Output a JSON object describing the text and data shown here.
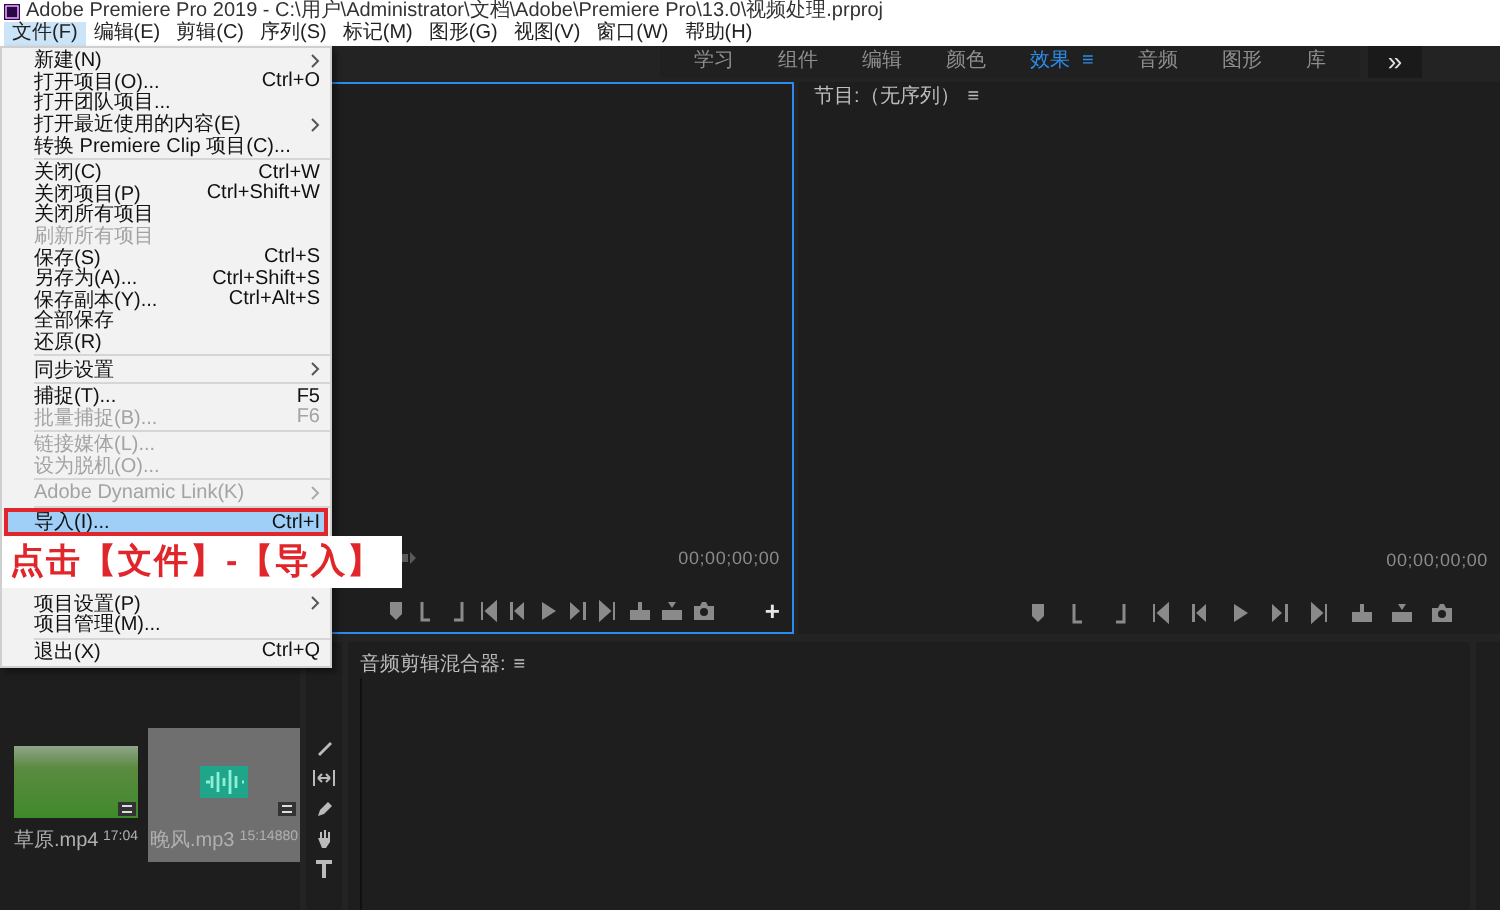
{
  "window": {
    "title": "Adobe Premiere Pro 2019 - C:\\用户\\Administrator\\文档\\Adobe\\Premiere Pro\\13.0\\视频处理.prproj"
  },
  "menu_bar": [
    {
      "label": "文件(F)",
      "selected": true
    },
    {
      "label": "编辑(E)",
      "selected": false
    },
    {
      "label": "剪辑(C)",
      "selected": false
    },
    {
      "label": "序列(S)",
      "selected": false
    },
    {
      "label": "标记(M)",
      "selected": false
    },
    {
      "label": "图形(G)",
      "selected": false
    },
    {
      "label": "视图(V)",
      "selected": false
    },
    {
      "label": "窗口(W)",
      "selected": false
    },
    {
      "label": "帮助(H)",
      "selected": false
    }
  ],
  "file_menu": {
    "items": [
      {
        "kind": "item",
        "label": "新建(N)",
        "submenu": true,
        "disabled": false,
        "selected": false
      },
      {
        "kind": "item",
        "label": "打开项目(O)...",
        "shortcut": "Ctrl+O",
        "disabled": false,
        "selected": false
      },
      {
        "kind": "item",
        "label": "打开团队项目...",
        "disabled": false,
        "selected": false
      },
      {
        "kind": "item",
        "label": "打开最近使用的内容(E)",
        "submenu": true,
        "disabled": false,
        "selected": false
      },
      {
        "kind": "item",
        "label": "转换 Premiere Clip 项目(C)...",
        "disabled": false,
        "selected": false
      },
      {
        "kind": "separator"
      },
      {
        "kind": "item",
        "label": "关闭(C)",
        "shortcut": "Ctrl+W",
        "disabled": false,
        "selected": false
      },
      {
        "kind": "item",
        "label": "关闭项目(P)",
        "shortcut": "Ctrl+Shift+W",
        "disabled": false,
        "selected": false
      },
      {
        "kind": "item",
        "label": "关闭所有项目",
        "disabled": false,
        "selected": false
      },
      {
        "kind": "item",
        "label": "刷新所有项目",
        "disabled": true,
        "selected": false
      },
      {
        "kind": "item",
        "label": "保存(S)",
        "shortcut": "Ctrl+S",
        "disabled": false,
        "selected": false
      },
      {
        "kind": "item",
        "label": "另存为(A)...",
        "shortcut": "Ctrl+Shift+S",
        "disabled": false,
        "selected": false
      },
      {
        "kind": "item",
        "label": "保存副本(Y)...",
        "shortcut": "Ctrl+Alt+S",
        "disabled": false,
        "selected": false
      },
      {
        "kind": "item",
        "label": "全部保存",
        "disabled": false,
        "selected": false
      },
      {
        "kind": "item",
        "label": "还原(R)",
        "disabled": false,
        "selected": false
      },
      {
        "kind": "separator"
      },
      {
        "kind": "item",
        "label": "同步设置",
        "submenu": true,
        "disabled": false,
        "selected": false
      },
      {
        "kind": "separator"
      },
      {
        "kind": "item",
        "label": "捕捉(T)...",
        "shortcut": "F5",
        "disabled": false,
        "selected": false
      },
      {
        "kind": "item",
        "label": "批量捕捉(B)...",
        "shortcut": "F6",
        "disabled": true,
        "selected": false
      },
      {
        "kind": "separator"
      },
      {
        "kind": "item",
        "label": "链接媒体(L)...",
        "disabled": true,
        "selected": false
      },
      {
        "kind": "item",
        "label": "设为脱机(O)...",
        "disabled": true,
        "selected": false
      },
      {
        "kind": "separator"
      },
      {
        "kind": "item",
        "label": "Adobe Dynamic Link(K)",
        "submenu": true,
        "disabled": true,
        "selected": false
      },
      {
        "kind": "separator"
      },
      {
        "kind": "item",
        "label": "导入(I)...",
        "shortcut": "Ctrl+I",
        "disabled": false,
        "selected": true
      },
      {
        "kind": "callout",
        "label": "点击【文件】-【导入】"
      },
      {
        "kind": "item",
        "label": "项目设置(P)",
        "submenu": true,
        "disabled": false,
        "selected": false
      },
      {
        "kind": "item",
        "label": "项目管理(M)...",
        "disabled": false,
        "selected": false
      },
      {
        "kind": "separator"
      },
      {
        "kind": "item",
        "label": "退出(X)",
        "shortcut": "Ctrl+Q",
        "disabled": false,
        "selected": false
      }
    ]
  },
  "workspace_tabs": {
    "tabs": [
      {
        "label": "学习",
        "selected": false
      },
      {
        "label": "组件",
        "selected": false
      },
      {
        "label": "编辑",
        "selected": false
      },
      {
        "label": "颜色",
        "selected": false
      },
      {
        "label": "效果",
        "selected": true,
        "menu_glyph": "≡"
      },
      {
        "label": "音频",
        "selected": false
      },
      {
        "label": "图形",
        "selected": false
      },
      {
        "label": "库",
        "selected": false
      }
    ],
    "overflow_button": "»"
  },
  "source_panel": {
    "timecode": "00;00;00;00",
    "add_button": "+"
  },
  "program_panel": {
    "title": "节目:（无序列）",
    "menu_glyph": "≡",
    "timecode": "00;00;00;00"
  },
  "project_panel": {
    "items": [
      {
        "kind": "video",
        "name": "草原.mp4",
        "duration": "17:04",
        "selected": false
      },
      {
        "kind": "audio",
        "name": "晚风.mp3",
        "duration": "15:14880",
        "selected": true
      }
    ]
  },
  "timeline_panel": {
    "title": "音频剪辑混合器:",
    "menu_glyph": "≡"
  }
}
